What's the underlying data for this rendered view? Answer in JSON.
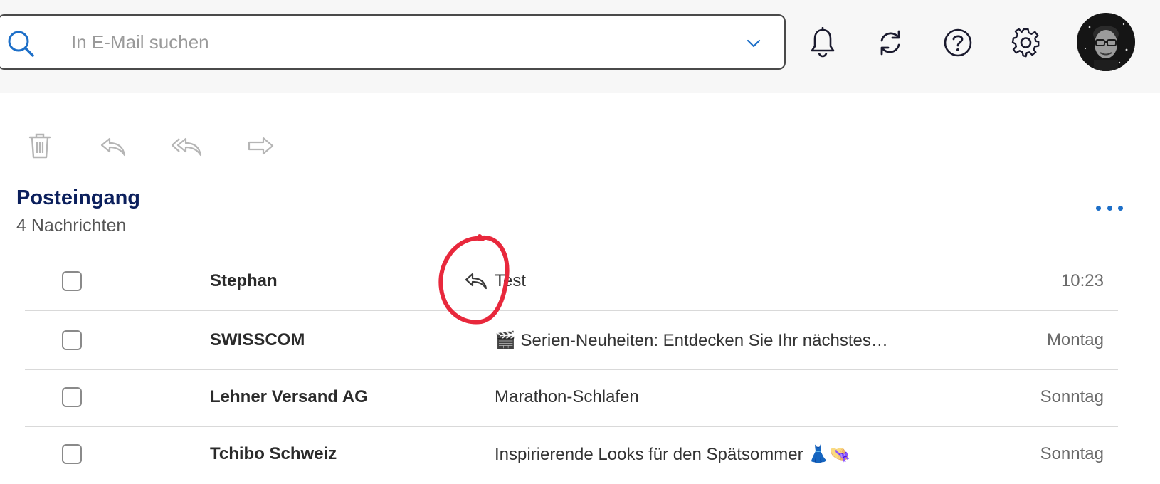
{
  "search": {
    "placeholder": "In E-Mail suchen"
  },
  "toolbar": {
    "delete": "trash-icon",
    "reply": "reply-icon",
    "reply_all": "reply-all-icon",
    "forward": "forward-icon"
  },
  "header_icons": [
    "bell-icon",
    "refresh-icon",
    "help-icon",
    "gear-icon"
  ],
  "folder": {
    "title": "Posteingang",
    "count": "4 Nachrichten"
  },
  "messages": [
    {
      "sender": "Stephan",
      "subject": "Test",
      "date": "10:23",
      "replied": true
    },
    {
      "sender": "SWISSCOM",
      "subject": "🎬 Serien-Neuheiten: Entdecken Sie Ihr nächstes…",
      "date": "Montag",
      "replied": false
    },
    {
      "sender": "Lehner Versand AG",
      "subject": "Marathon-Schlafen",
      "date": "Sonntag",
      "replied": false
    },
    {
      "sender": "Tchibo Schweiz",
      "subject": "Inspirierende Looks für den Spätsommer 👗👒",
      "date": "Sonntag",
      "replied": false
    }
  ],
  "colors": {
    "accent": "#1d6fc8",
    "title": "#0b1f5c",
    "annotation": "#e8283c"
  }
}
